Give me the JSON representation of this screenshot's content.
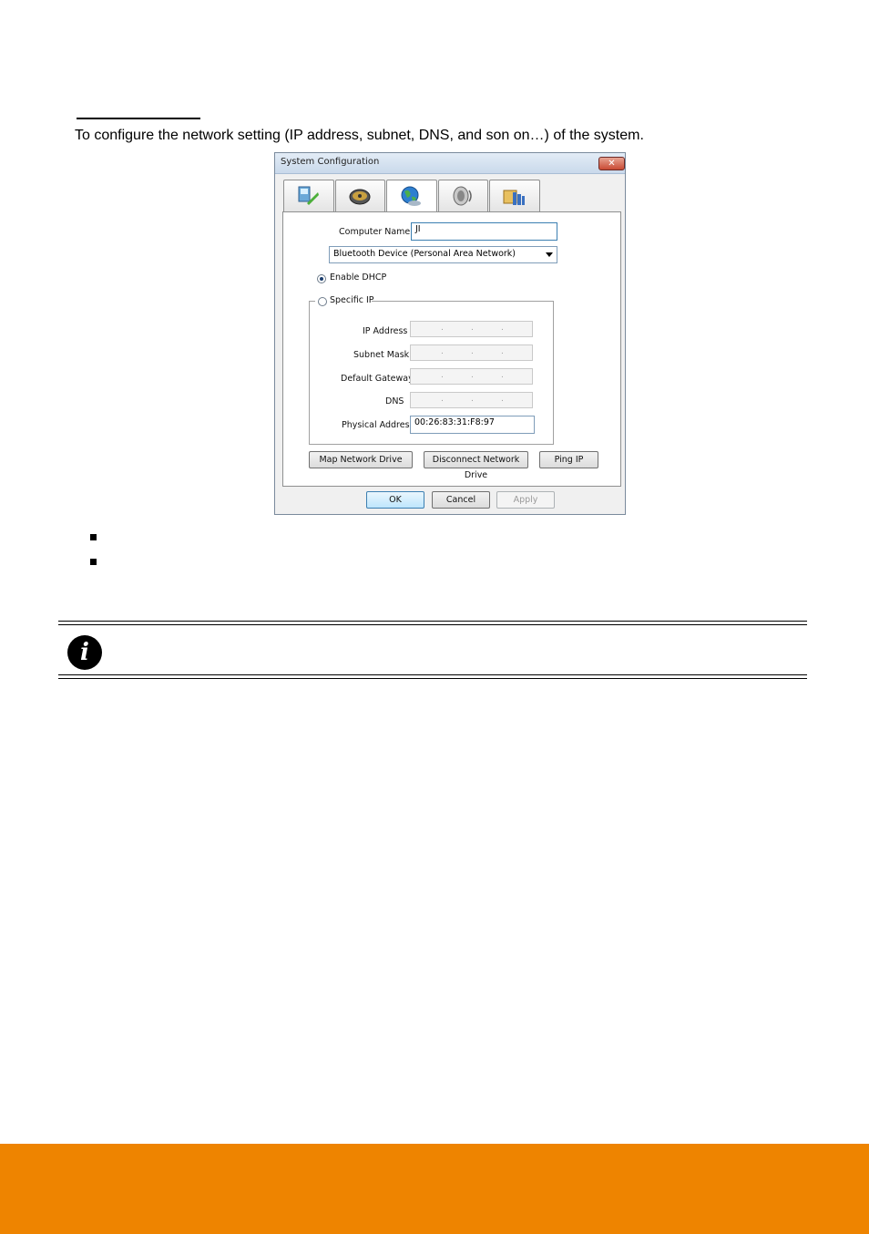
{
  "intro_text": "To configure the network setting (IP address, subnet, DNS, and son on…) of the system.",
  "dialog": {
    "title": "System Configuration",
    "close_label": "✕",
    "tabs": [
      {
        "icon": "system-icon",
        "active": false
      },
      {
        "icon": "hard-disk-icon",
        "active": false
      },
      {
        "icon": "network-globe-icon",
        "active": true
      },
      {
        "icon": "speaker-icon",
        "active": false
      },
      {
        "icon": "folder-tools-icon",
        "active": false
      }
    ],
    "computer_name_label": "Computer Name",
    "computer_name_value": "JI",
    "adapter_selected": "Bluetooth Device (Personal Area Network)",
    "enable_dhcp_label": "Enable DHCP",
    "enable_dhcp_checked": true,
    "specific_ip_label": "Specific IP",
    "specific_ip_checked": false,
    "fields": {
      "ip_address_label": "IP Address",
      "subnet_mask_label": "Subnet Mask",
      "default_gateway_label": "Default Gateway",
      "dns_label": "DNS",
      "physical_address_label": "Physical Address",
      "physical_address_value": "00:26:83:31:F8:97",
      "ip_separator": "."
    },
    "buttons": {
      "map_network_drive": "Map Network Drive",
      "disconnect_network_drive": "Disconnect Network Drive",
      "ping_ip": "Ping IP",
      "ok": "OK",
      "cancel": "Cancel",
      "apply": "Apply"
    }
  },
  "note_icon_label": "i",
  "colors": {
    "footer": "#ee8400",
    "title_bar": "#c9d9eb",
    "close_button": "#c94a33"
  }
}
